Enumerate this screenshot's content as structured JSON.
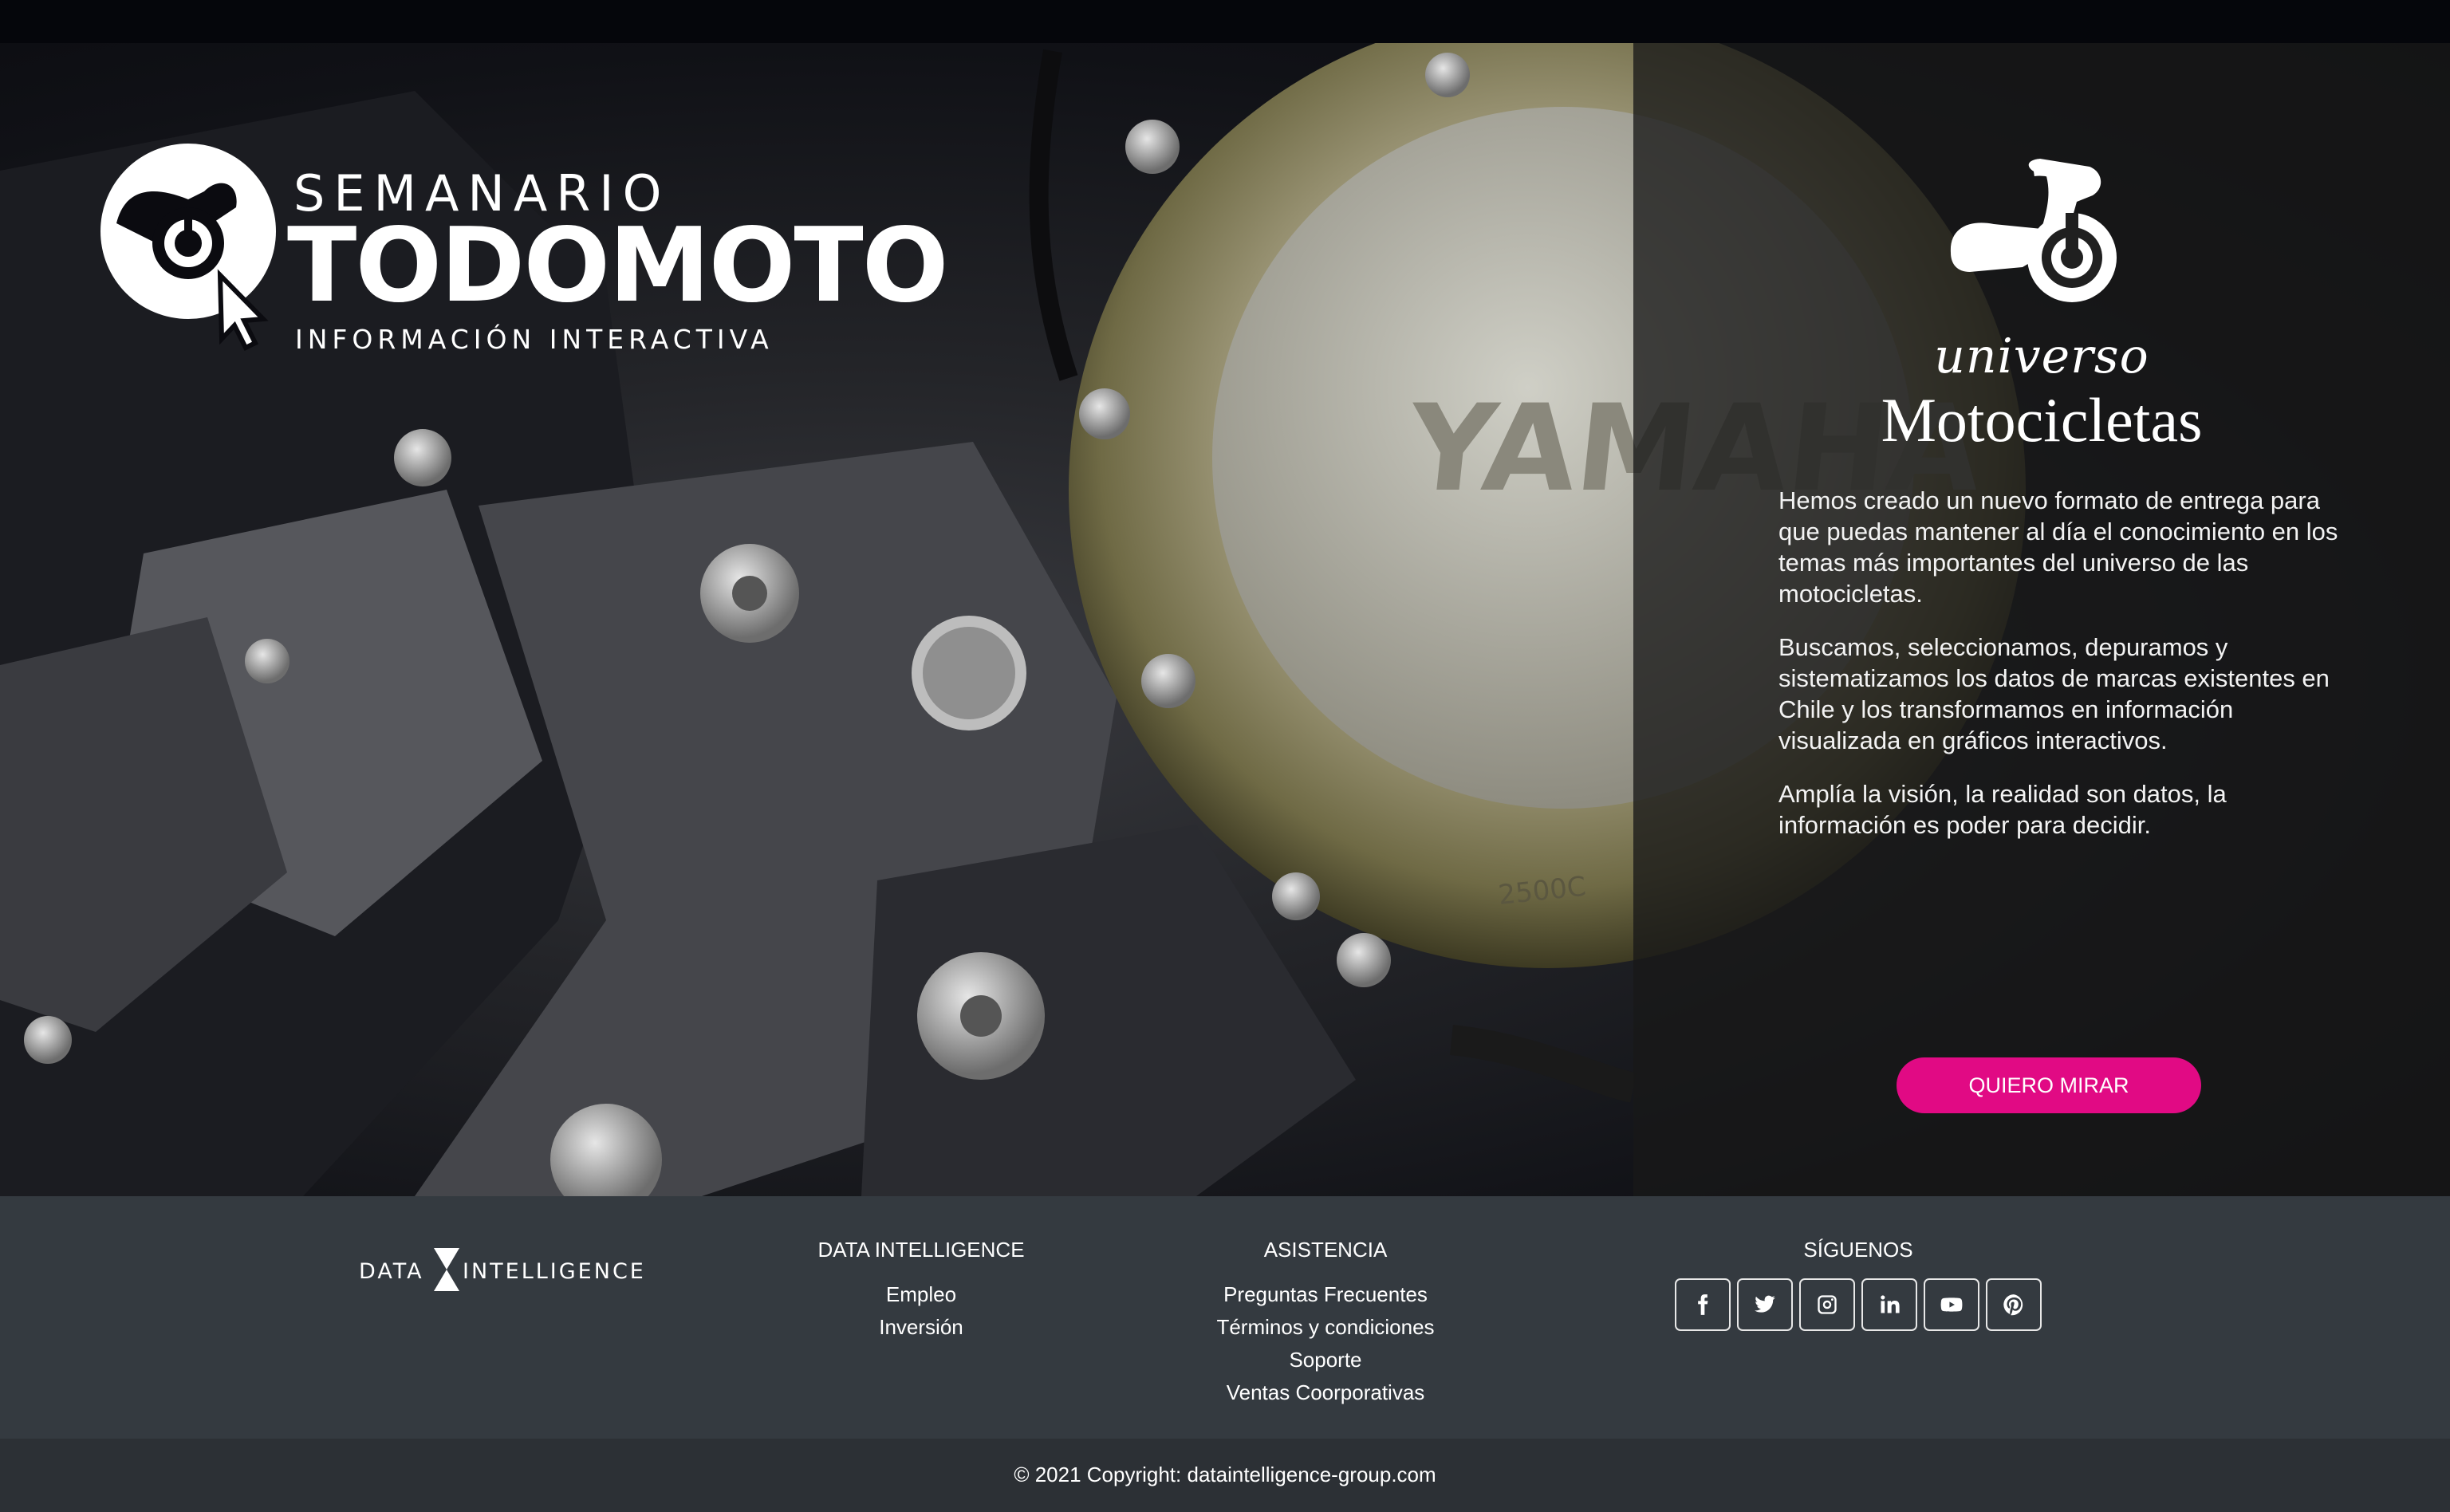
{
  "logo": {
    "line1": "SEMANARIO",
    "line2": "TODOMOTO",
    "line3": "INFORMACIÓN INTERACTIVA"
  },
  "hero": {
    "engraving": "YAMAHA",
    "small_engraving": "2500C"
  },
  "panel": {
    "icon": "motorcycle-icon",
    "universo": "universo",
    "title": "Motocicletas",
    "paragraphs": [
      "Hemos creado un nuevo formato de entrega para que puedas mantener al día el conocimiento en los temas más importantes del universo de las motocicletas.",
      "Buscamos, seleccionamos, depuramos y sistematizamos los datos de marcas existentes en Chile y los transformamos en información visualizada en gráficos interactivos.",
      "Amplía la visión, la realidad son datos, la información es poder para decidir."
    ],
    "cta_label": "QUIERO MIRAR",
    "cta_color": "#e10a84"
  },
  "footer": {
    "brand_left": "DATA",
    "brand_right": "INTELLIGENCE",
    "data_intelligence": {
      "heading": "DATA INTELLIGENCE",
      "links": [
        "Empleo",
        "Inversión"
      ]
    },
    "asistencia": {
      "heading": "ASISTENCIA",
      "links": [
        "Preguntas Frecuentes",
        "Términos y condiciones",
        "Soporte",
        "Ventas Coorporativas"
      ]
    },
    "siguenos": {
      "heading": "SÍGUENOS",
      "icons": [
        "facebook-icon",
        "twitter-icon",
        "instagram-icon",
        "linkedin-icon",
        "youtube-icon",
        "pinterest-icon"
      ]
    },
    "copyright": "© 2021 Copyright: dataintelligence-group.com"
  }
}
